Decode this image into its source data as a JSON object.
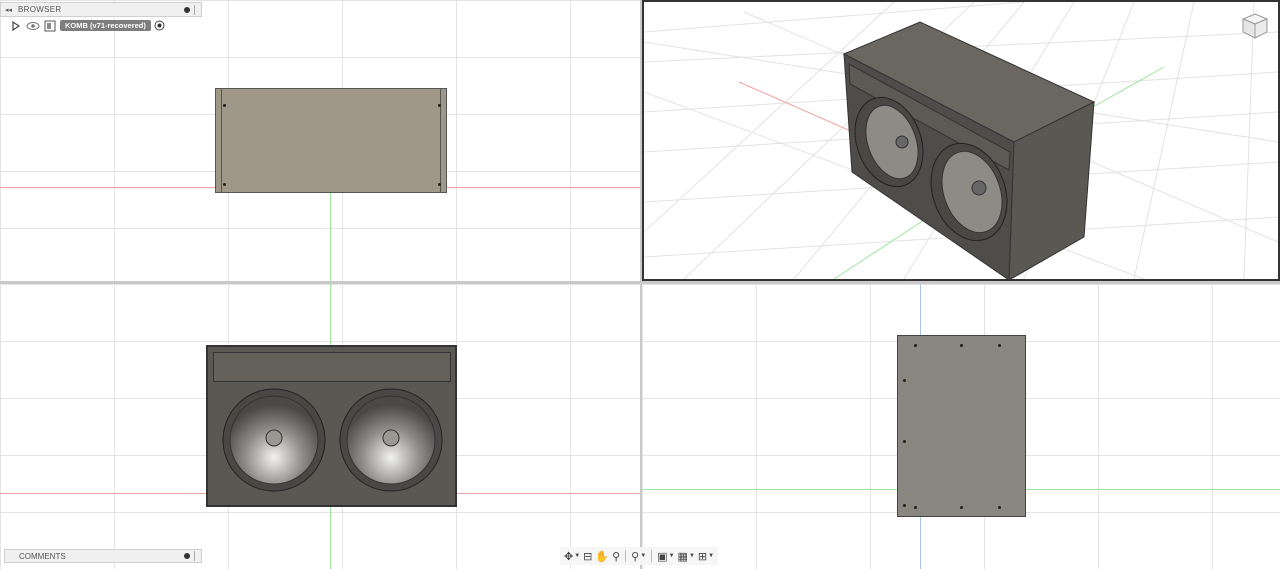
{
  "browser": {
    "title": "BROWSER",
    "component_label": "KOMB (v71-recovered)"
  },
  "comments": {
    "title": "COMMENTS"
  },
  "icons": {
    "collapse": "double-left-arrow-icon",
    "pin": "pin-icon",
    "expand": "expand-triangle-icon",
    "visibility": "eye-icon",
    "component": "component-icon",
    "activate": "radio-target-icon",
    "viewcube": "viewcube-icon",
    "toolbar": [
      "orbit-icon",
      "look-at-icon",
      "pan-icon",
      "zoom-icon",
      "zoom-window-icon",
      "display-settings-icon",
      "grid-settings-icon",
      "viewports-icon"
    ]
  },
  "colors": {
    "part": "#9f9888",
    "part_dark": "#5a5853",
    "axis_red": "#f0a0a0",
    "axis_green": "#9fe59f"
  }
}
